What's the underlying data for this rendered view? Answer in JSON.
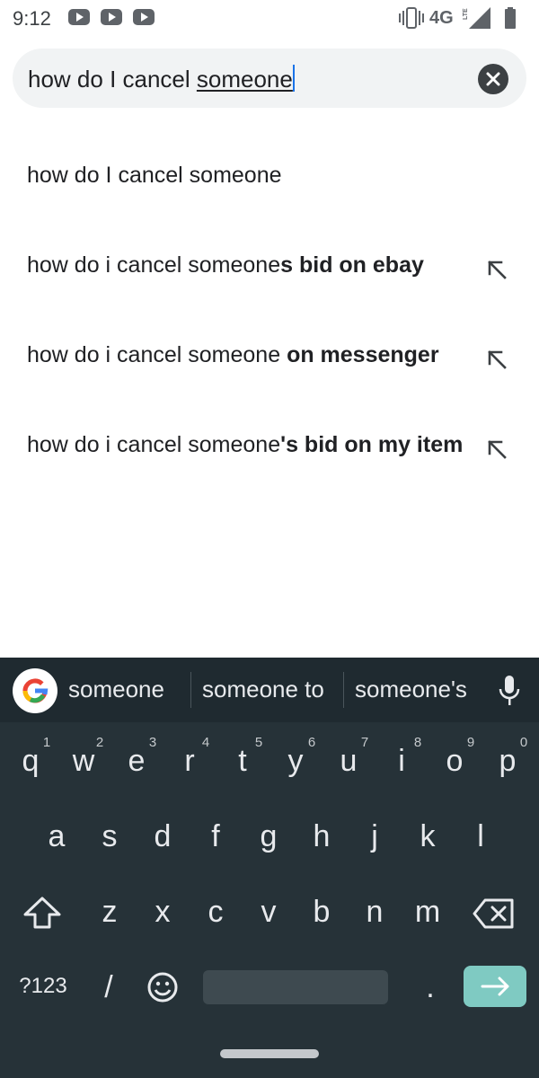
{
  "status_bar": {
    "time": "9:12",
    "network": "4G",
    "network_sub": "LTE",
    "notification_icons": [
      "youtube-icon",
      "youtube-icon",
      "youtube-icon"
    ],
    "right_icons": [
      "vibrate-icon",
      "signal-icon",
      "battery-icon"
    ]
  },
  "search": {
    "query_prefix": "how do I cancel ",
    "query_composing": "someone",
    "clear_icon": "clear-icon"
  },
  "suggestions": [
    {
      "normal": "how do I cancel someone",
      "bold": "",
      "has_arrow": false
    },
    {
      "normal": "how do i cancel someone",
      "bold": "s bid on ebay",
      "has_arrow": true
    },
    {
      "normal": "how do i cancel someone ",
      "bold": "on messenger",
      "has_arrow": true
    },
    {
      "normal": "how do i cancel someone",
      "bold": "'s bid on my item",
      "has_arrow": true
    }
  ],
  "keyboard": {
    "word_suggestions": [
      "someone",
      "someone to",
      "someone's"
    ],
    "row1": [
      "q",
      "w",
      "e",
      "r",
      "t",
      "y",
      "u",
      "i",
      "o",
      "p"
    ],
    "row1_hints": [
      "1",
      "2",
      "3",
      "4",
      "5",
      "6",
      "7",
      "8",
      "9",
      "0"
    ],
    "row2": [
      "a",
      "s",
      "d",
      "f",
      "g",
      "h",
      "j",
      "k",
      "l"
    ],
    "row3": [
      "z",
      "x",
      "c",
      "v",
      "b",
      "n",
      "m"
    ],
    "symbols_label": "?123",
    "slash_label": "/",
    "period_label": ".",
    "accent_color": "#7fcac2",
    "background_color": "#263238"
  }
}
